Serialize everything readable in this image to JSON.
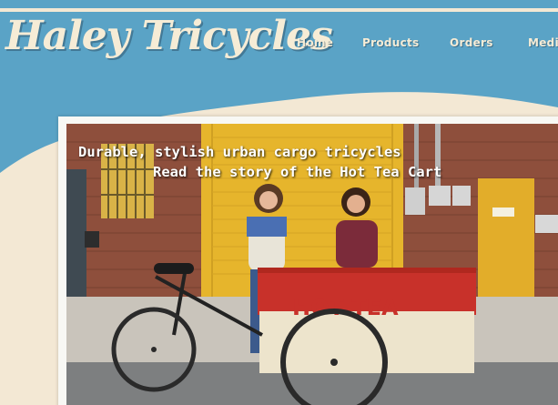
{
  "site": {
    "logo_text": "Haley Tricycles"
  },
  "nav": {
    "items": [
      {
        "label": "Home"
      },
      {
        "label": "Products"
      },
      {
        "label": "Orders"
      },
      {
        "label": "Medi"
      }
    ]
  },
  "hero": {
    "caption_line1": "Durable, stylish urban cargo tricycles",
    "caption_line2": "Read the story of the Hot Tea Cart",
    "cart_sign": "HOT TEA"
  },
  "colors": {
    "header_blue": "#5aa3c6",
    "cream": "#f3e8d4",
    "cart_red": "#c8312a",
    "door_yellow": "#e6b52c"
  }
}
